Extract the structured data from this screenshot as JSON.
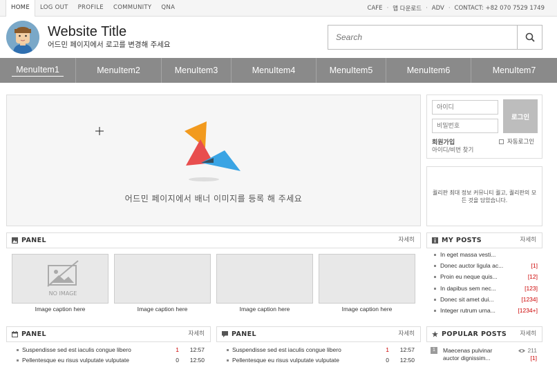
{
  "topbar": {
    "links": [
      "HOME",
      "LOG OUT",
      "PROFILE",
      "COMMUNITY",
      "QNA"
    ],
    "right": [
      "CAFE",
      "앱 다운로드",
      "ADV",
      "CONTACT: +82 070 7529 1749"
    ]
  },
  "header": {
    "title": "Website Title",
    "subtitle": "어드민 페이지에서 로고를 변경해 주세요",
    "search_placeholder": "Search"
  },
  "nav": {
    "items": [
      "MenuItem1",
      "MenuItem2",
      "MenuItem3",
      "MenuItem4",
      "MenuItem5",
      "MenuItem6",
      "MenuItem7"
    ],
    "active_index": 0
  },
  "banner": {
    "text": "어드민 페이지에서 배너 이미지를 등록 해 주세요"
  },
  "login": {
    "id_placeholder": "아이디",
    "pw_placeholder": "비밀번호",
    "button": "로그인",
    "join": "회원가입",
    "find": "아이디/비번 찾기",
    "auto": "자동로그인"
  },
  "info": {
    "text": "퀄리판 최대 정보 커뮤니티 퀄고, 퀄리판의 모든 것을 담았습니다."
  },
  "gallery_panel": {
    "title": "PANEL",
    "more": "자세히",
    "no_image": "NO IMAGE",
    "items": [
      "Image caption here",
      "Image caption here",
      "Image caption here",
      "Image caption here"
    ]
  },
  "my_posts": {
    "title": "MY POSTS",
    "more": "자세히",
    "items": [
      {
        "title": "In eget massa vesti...",
        "count": ""
      },
      {
        "title": "Donec auctor ligula ac...",
        "count": "[1]"
      },
      {
        "title": "Proin eu neque quis...",
        "count": "[12]"
      },
      {
        "title": "In dapibus sem nec...",
        "count": "[123]"
      },
      {
        "title": "Donec sit amet dui...",
        "count": "[1234]"
      },
      {
        "title": "Integer rutrum urna...",
        "count": "[1234+]"
      }
    ]
  },
  "panel_left": {
    "title": "PANEL",
    "more": "자세히",
    "rows": [
      {
        "title": "Suspendisse sed est iaculis congue libero",
        "num": "1",
        "time": "12:57",
        "red": true
      },
      {
        "title": "Pellentesque eu risus vulputate vulputate",
        "num": "0",
        "time": "12:50",
        "red": false
      }
    ]
  },
  "panel_mid": {
    "title": "PANEL",
    "more": "자세히",
    "rows": [
      {
        "title": "Suspendisse sed est iaculis congue libero",
        "num": "1",
        "time": "12:57",
        "red": true
      },
      {
        "title": "Pellentesque eu risus vulputate vulputate",
        "num": "0",
        "time": "12:50",
        "red": false
      }
    ]
  },
  "popular": {
    "title": "POPULAR POSTS",
    "more": "자세히",
    "items": [
      {
        "rank": "1",
        "line1": "Maecenas pulvinar",
        "line2": "auctor dignissim...",
        "views": "211",
        "count": "[1]"
      }
    ]
  },
  "colors": {
    "nav_bg": "#8a8a8a",
    "login_button": "#bdbdbd",
    "highlight_red": "#cc0000"
  }
}
